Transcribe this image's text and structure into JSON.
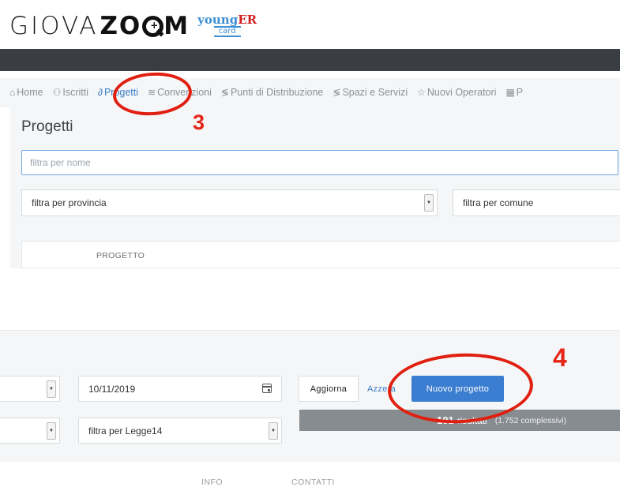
{
  "logo": {
    "light_text": "GIOVA",
    "bold_text_1": "ZO",
    "bold_text_2": "M",
    "badge_young": "young",
    "badge_er": "ER",
    "badge_card": "card"
  },
  "nav": {
    "items": [
      {
        "label": "Home",
        "icon": "home-icon"
      },
      {
        "label": "Iscritti",
        "icon": "users-icon"
      },
      {
        "label": "Progetti",
        "icon": "link-icon",
        "active": true
      },
      {
        "label": "Convenzioni",
        "icon": "rss-icon"
      },
      {
        "label": "Punti di Distribuzione",
        "icon": "layers-icon"
      },
      {
        "label": "Spazi e Servizi",
        "icon": "layers-icon"
      },
      {
        "label": "Nuovi Operatori",
        "icon": "star-icon"
      },
      {
        "label": "P",
        "icon": "grid-icon"
      }
    ]
  },
  "page": {
    "title": "Progetti",
    "annotation_step_3": "3",
    "annotation_step_4": "4"
  },
  "filters": {
    "name_placeholder": "filtra per nome",
    "provincia": "filtra per provincia",
    "comune": "filtra per comune",
    "date_value": "10/11/2019",
    "legge14": "filtra per Legge14"
  },
  "table": {
    "column_progetto": "PROGETTO"
  },
  "actions": {
    "aggiorna": "Aggiorna",
    "azzera": "Azzera",
    "nuovo_progetto": "Nuovo progetto"
  },
  "results": {
    "count": "101",
    "label": "risultati",
    "total": "(1.752 complessivi)"
  },
  "footer": {
    "info": "INFO",
    "contatti": "CONTATTI"
  },
  "colors": {
    "accent": "#3b7dd0",
    "annotation": "#e32618",
    "dark_bar": "#3a3d43"
  }
}
